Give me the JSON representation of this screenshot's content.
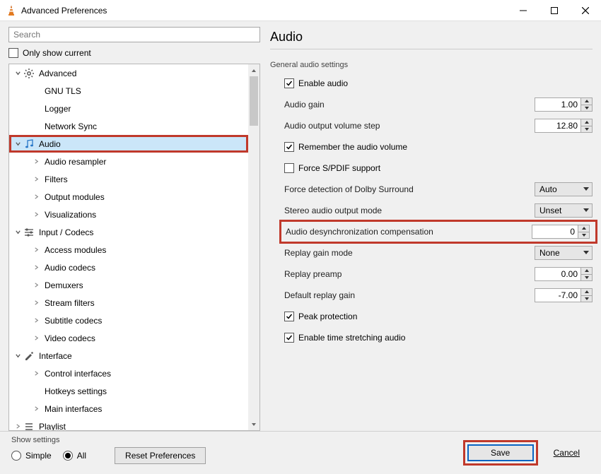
{
  "window": {
    "title": "Advanced Preferences"
  },
  "search": {
    "placeholder": "Search"
  },
  "only_show_current": "Only show current",
  "tree": {
    "advanced": {
      "label": "Advanced",
      "children": [
        "GNU TLS",
        "Logger",
        "Network Sync"
      ]
    },
    "audio": {
      "label": "Audio",
      "children": [
        "Audio resampler",
        "Filters",
        "Output modules",
        "Visualizations"
      ]
    },
    "input_codecs": {
      "label": "Input / Codecs",
      "children": [
        "Access modules",
        "Audio codecs",
        "Demuxers",
        "Stream filters",
        "Subtitle codecs",
        "Video codecs"
      ]
    },
    "interface": {
      "label": "Interface",
      "children": [
        "Control interfaces",
        "Hotkeys settings",
        "Main interfaces"
      ]
    },
    "playlist": {
      "label": "Playlist"
    }
  },
  "panel": {
    "title": "Audio",
    "section": "General audio settings",
    "enable_audio": "Enable audio",
    "audio_gain": {
      "label": "Audio gain",
      "value": "1.00"
    },
    "volume_step": {
      "label": "Audio output volume step",
      "value": "12.80"
    },
    "remember_volume": "Remember the audio volume",
    "force_spdif": "Force S/PDIF support",
    "dolby": {
      "label": "Force detection of Dolby Surround",
      "value": "Auto"
    },
    "stereo_mode": {
      "label": "Stereo audio output mode",
      "value": "Unset"
    },
    "desync": {
      "label": "Audio desynchronization compensation",
      "value": "0"
    },
    "replay_mode": {
      "label": "Replay gain mode",
      "value": "None"
    },
    "replay_preamp": {
      "label": "Replay preamp",
      "value": "0.00"
    },
    "default_replay": {
      "label": "Default replay gain",
      "value": "-7.00"
    },
    "peak_protection": "Peak protection",
    "time_stretching": "Enable time stretching audio"
  },
  "bottom": {
    "show_settings": "Show settings",
    "simple": "Simple",
    "all": "All",
    "reset": "Reset Preferences",
    "save": "Save",
    "cancel": "Cancel"
  }
}
